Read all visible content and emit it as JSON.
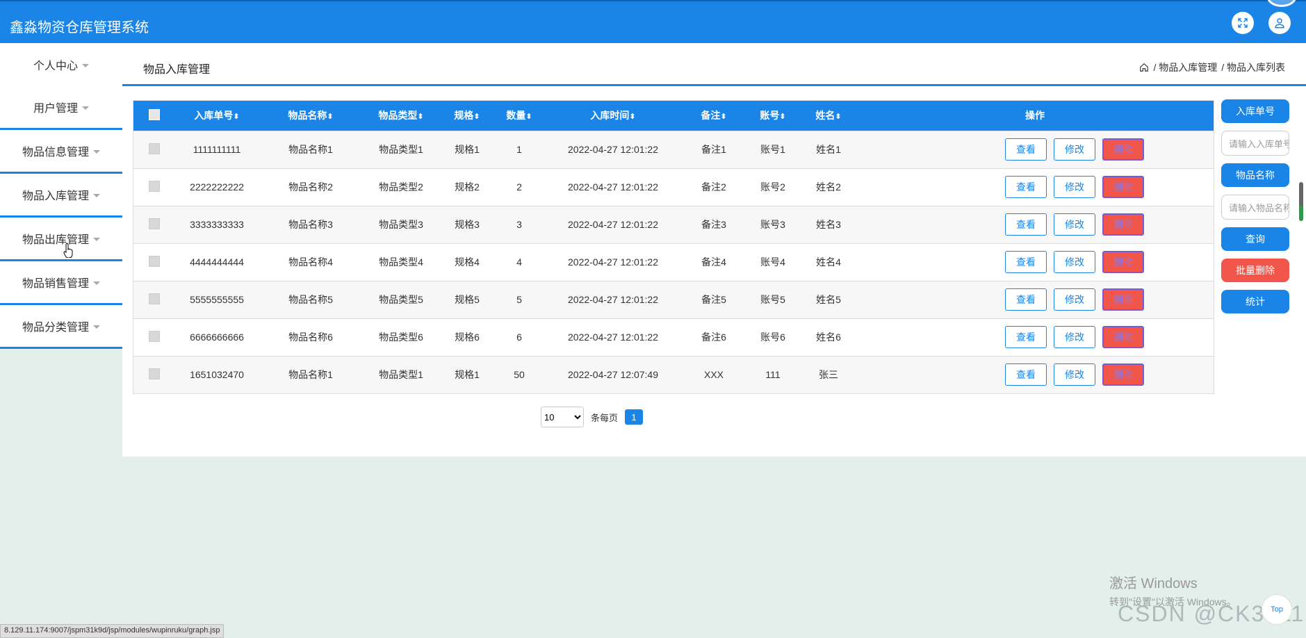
{
  "app": {
    "title": "鑫淼物资仓库管理系统"
  },
  "header": {
    "fullscreen_icon": "expand-icon",
    "user_icon": "user-icon"
  },
  "sidebar": {
    "items": [
      {
        "label": "个人中心"
      },
      {
        "label": "用户管理"
      },
      {
        "label": "物品信息管理"
      },
      {
        "label": "物品入库管理"
      },
      {
        "label": "物品出库管理"
      },
      {
        "label": "物品销售管理"
      },
      {
        "label": "物品分类管理"
      }
    ]
  },
  "page": {
    "title": "物品入库管理",
    "breadcrumb": [
      "/ 物品入库管理",
      "/ 物品入库列表"
    ]
  },
  "table": {
    "sort_mark": "⬍",
    "columns": [
      "入库单号",
      "物品名称",
      "物品类型",
      "规格",
      "数量",
      "入库时间",
      "备注",
      "账号",
      "姓名",
      "操作"
    ],
    "rows": [
      {
        "no": "1111111111",
        "name": "物品名称1",
        "type": "物品类型1",
        "spec": "规格1",
        "qty": "1",
        "time": "2022-04-27 12:01:22",
        "note": "备注1",
        "account": "账号1",
        "person": "姓名1"
      },
      {
        "no": "2222222222",
        "name": "物品名称2",
        "type": "物品类型2",
        "spec": "规格2",
        "qty": "2",
        "time": "2022-04-27 12:01:22",
        "note": "备注2",
        "account": "账号2",
        "person": "姓名2"
      },
      {
        "no": "3333333333",
        "name": "物品名称3",
        "type": "物品类型3",
        "spec": "规格3",
        "qty": "3",
        "time": "2022-04-27 12:01:22",
        "note": "备注3",
        "account": "账号3",
        "person": "姓名3"
      },
      {
        "no": "4444444444",
        "name": "物品名称4",
        "type": "物品类型4",
        "spec": "规格4",
        "qty": "4",
        "time": "2022-04-27 12:01:22",
        "note": "备注4",
        "account": "账号4",
        "person": "姓名4"
      },
      {
        "no": "5555555555",
        "name": "物品名称5",
        "type": "物品类型5",
        "spec": "规格5",
        "qty": "5",
        "time": "2022-04-27 12:01:22",
        "note": "备注5",
        "account": "账号5",
        "person": "姓名5"
      },
      {
        "no": "6666666666",
        "name": "物品名称6",
        "type": "物品类型6",
        "spec": "规格6",
        "qty": "6",
        "time": "2022-04-27 12:01:22",
        "note": "备注6",
        "account": "账号6",
        "person": "姓名6"
      },
      {
        "no": "1651032470",
        "name": "物品名称1",
        "type": "物品类型1",
        "spec": "规格1",
        "qty": "50",
        "time": "2022-04-27 12:07:49",
        "note": "XXX",
        "account": "111",
        "person": "张三"
      }
    ],
    "actions": {
      "view": "查看",
      "edit": "修改",
      "delete": "删除"
    }
  },
  "pagination": {
    "page_size": "10",
    "per_page_label": "条每页",
    "current_page": "1"
  },
  "search": {
    "field1_label": "入库单号",
    "field1_placeholder": "请输入入库单号",
    "field2_label": "物品名称",
    "field2_placeholder": "请输入物品名称",
    "query_button": "查询",
    "batch_delete_button": "批量删除",
    "stats_button": "统计"
  },
  "statusbar": {
    "url": "8.129.11.174:9007/jspm31k9d/jsp/modules/wupinruku/graph.jsp"
  },
  "overlay": {
    "windows_title": "激活 Windows",
    "windows_sub": "转到\"设置\"以激活 Windows。",
    "watermark": "CSDN @CK3011",
    "totop": "Top"
  },
  "colors": {
    "primary": "#1a85e6",
    "danger": "#f2554a",
    "background": "#e2efea"
  }
}
